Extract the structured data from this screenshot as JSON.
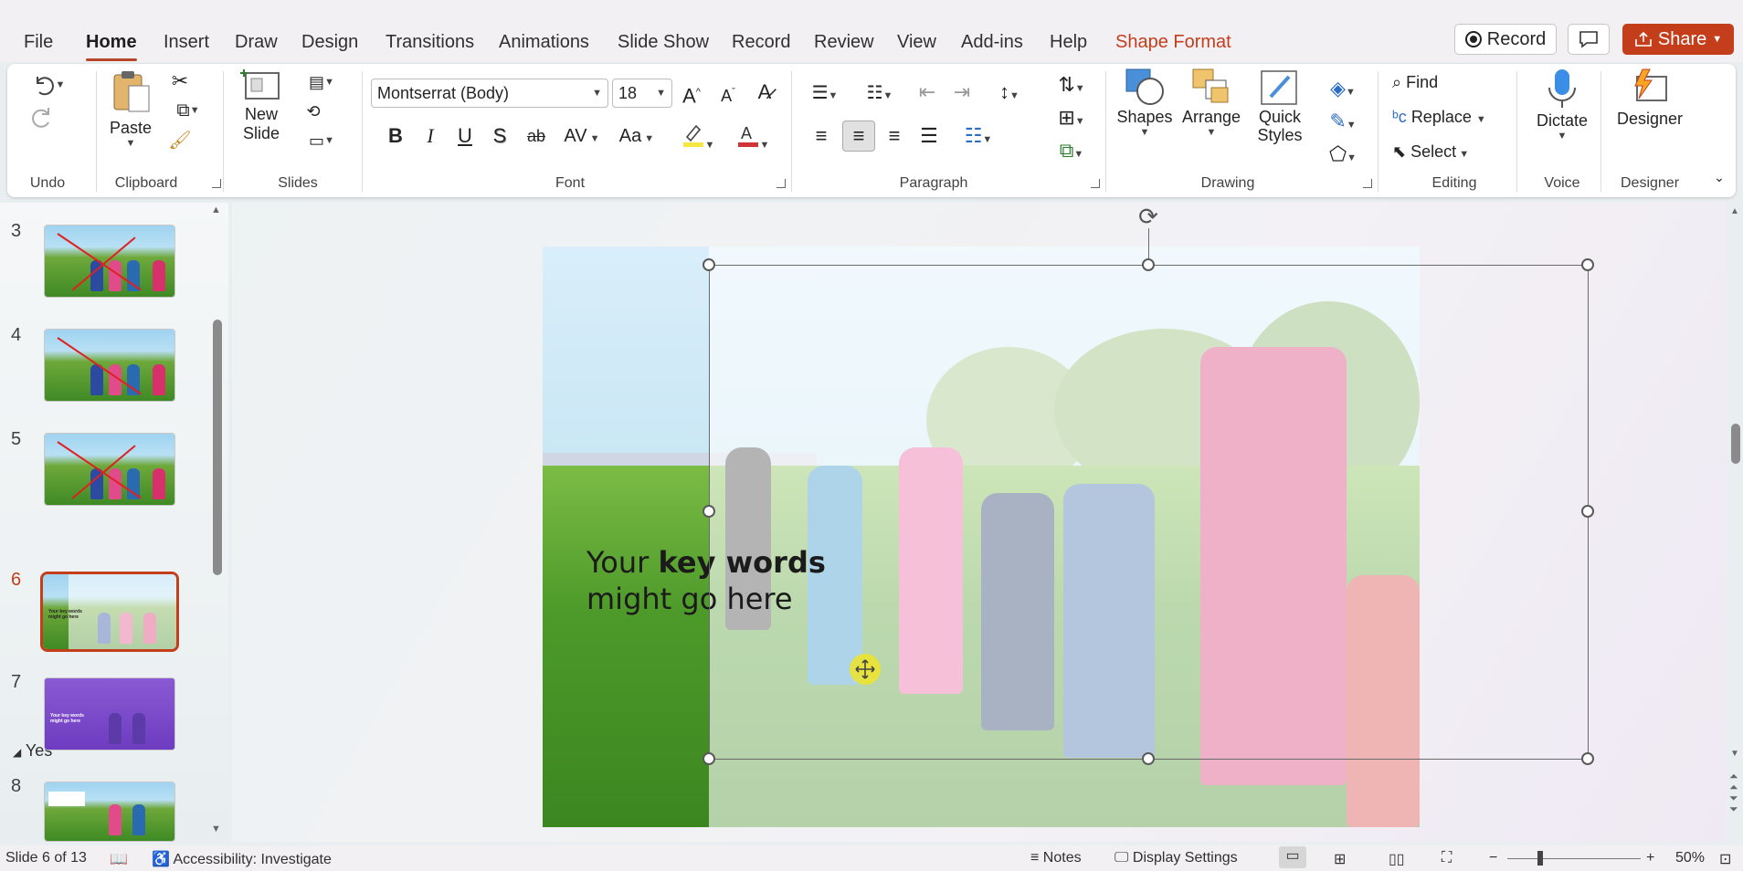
{
  "tabs": [
    {
      "label": "File",
      "active": false
    },
    {
      "label": "Home",
      "active": true
    },
    {
      "label": "Insert",
      "active": false
    },
    {
      "label": "Draw",
      "active": false
    },
    {
      "label": "Design",
      "active": false
    },
    {
      "label": "Transitions",
      "active": false
    },
    {
      "label": "Animations",
      "active": false
    },
    {
      "label": "Slide Show",
      "active": false
    },
    {
      "label": "Record",
      "active": false
    },
    {
      "label": "Review",
      "active": false
    },
    {
      "label": "View",
      "active": false
    },
    {
      "label": "Add-ins",
      "active": false
    },
    {
      "label": "Help",
      "active": false
    },
    {
      "label": "Shape Format",
      "active": false,
      "contextual": true
    }
  ],
  "header": {
    "record_label": "Record",
    "share_label": "Share"
  },
  "ribbon": {
    "groups": {
      "undo": "Undo",
      "clipboard": "Clipboard",
      "slides": "Slides",
      "font": "Font",
      "paragraph": "Paragraph",
      "drawing": "Drawing",
      "editing": "Editing",
      "voice": "Voice",
      "designer": "Designer"
    },
    "paste_label": "Paste",
    "new_slide_label_1": "New",
    "new_slide_label_2": "Slide",
    "font_name": "Montserrat (Body)",
    "font_size": "18",
    "shapes_label": "Shapes",
    "arrange_label": "Arrange",
    "quick_styles_label_1": "Quick",
    "quick_styles_label_2": "Styles",
    "find_label": "Find",
    "replace_label": "Replace",
    "select_label": "Select",
    "dictate_label": "Dictate",
    "designer_label": "Designer",
    "bold": "B",
    "italic": "I",
    "underline": "U",
    "shadow": "S",
    "strike": "ab",
    "spacing": "AV",
    "case": "Aa",
    "grow": "A",
    "shrink": "A",
    "highlight_color": "#f5e642",
    "font_color": "#d13438",
    "accent_color": "#c43e1c"
  },
  "thumbnails": [
    {
      "num": "3",
      "theme": "green",
      "active": false
    },
    {
      "num": "4",
      "theme": "green",
      "active": false
    },
    {
      "num": "5",
      "theme": "green",
      "active": false
    },
    {
      "num": "6",
      "theme": "green-light",
      "active": true
    },
    {
      "num": "7",
      "theme": "purple",
      "active": false
    },
    {
      "num": "8",
      "theme": "green",
      "active": false
    }
  ],
  "section_title": "Yes",
  "slide": {
    "text_plain_1": "Your ",
    "text_bold": "key words",
    "text_plain_2": "might go here"
  },
  "status": {
    "slide_info": "Slide 6 of 13",
    "accessibility": "Accessibility: Investigate",
    "notes": "Notes",
    "display_settings": "Display Settings",
    "zoom": "50%"
  }
}
